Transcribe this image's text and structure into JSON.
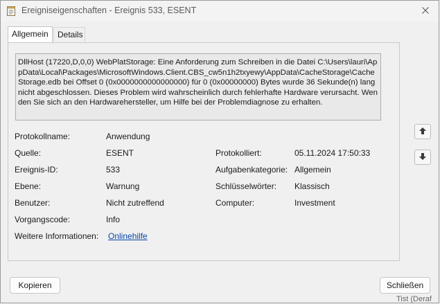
{
  "window": {
    "title": "Ereigniseigenschaften - Ereignis 533, ESENT",
    "app_icon": "event-log-icon",
    "close_icon": "close-icon"
  },
  "tabs": [
    {
      "label": "Allgemein",
      "active": true
    },
    {
      "label": "Details",
      "active": false
    }
  ],
  "message": "DllHost (17220,D,0,0) WebPlatStorage: Eine Anforderung zum Schreiben in die Datei C:\\Users\\lauri\\AppData\\Local\\Packages\\MicrosoftWindows.Client.CBS_cw5n1h2txyewy\\AppData\\CacheStorage\\CacheStorage.edb bei Offset 0 (0x0000000000000000) für 0 (0x00000000) Bytes wurde 36 Sekunde(n) lang nicht abgeschlossen. Dieses Problem wird wahrscheinlich durch fehlerhafte Hardware verursacht. Wenden Sie sich an den Hardwarehersteller, um Hilfe bei der Problemdiagnose zu erhalten.",
  "fields": {
    "protokollname": {
      "label": "Protokollname:",
      "value": "Anwendung"
    },
    "quelle": {
      "label": "Quelle:",
      "value": "ESENT"
    },
    "protokolliert": {
      "label": "Protokolliert:",
      "value": "05.11.2024 17:50:33"
    },
    "ereignis_id": {
      "label": "Ereignis-ID:",
      "value": "533"
    },
    "aufgabenkategorie": {
      "label": "Aufgabenkategorie:",
      "value": "Allgemein"
    },
    "ebene": {
      "label": "Ebene:",
      "value": "Warnung"
    },
    "schluesselwoerter": {
      "label": "Schlüsselwörter:",
      "value": "Klassisch"
    },
    "benutzer": {
      "label": "Benutzer:",
      "value": "Nicht zutreffend"
    },
    "computer": {
      "label": "Computer:",
      "value": "Investment"
    },
    "vorgangscode": {
      "label": "Vorgangscode:",
      "value": "Info"
    },
    "weitere_informationen": {
      "label": "Weitere Informationen:",
      "value": "Onlinehilfe"
    }
  },
  "nav": {
    "up_icon": "arrow-up-icon",
    "down_icon": "arrow-down-icon"
  },
  "buttons": {
    "copy": "Kopieren",
    "close": "Schließen"
  },
  "background_fragment": "Tist (Deraf"
}
